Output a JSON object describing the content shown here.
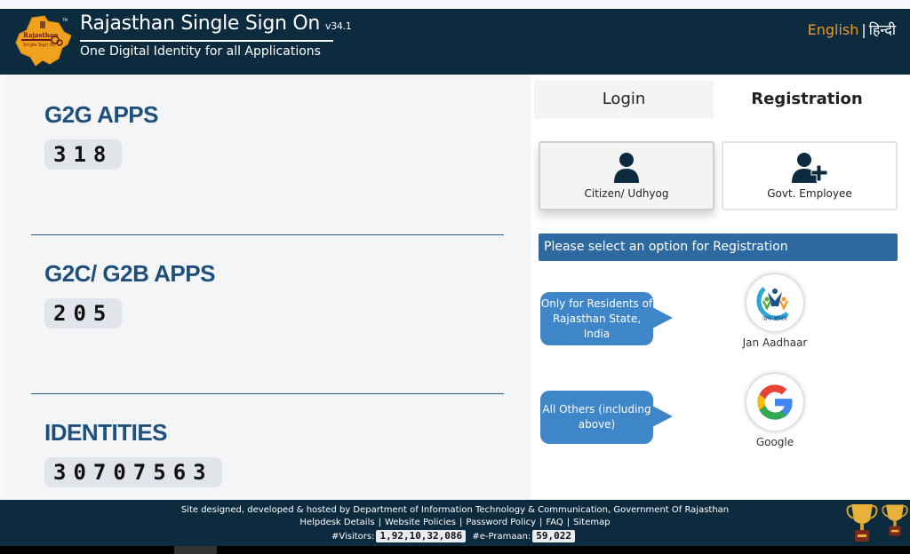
{
  "header": {
    "logo_icon": "rajasthan-sso-logo",
    "title": "Rajasthan Single Sign On",
    "version": "v34.1",
    "subtitle": "One Digital Identity for all Applications",
    "lang_english": "English",
    "lang_separator": "|",
    "lang_hindi": "हिन्दी"
  },
  "stats": [
    {
      "title": "G2G APPS",
      "value": "318"
    },
    {
      "title": "G2C/ G2B APPS",
      "value": "205"
    },
    {
      "title": "IDENTITIES",
      "value": "30707563"
    }
  ],
  "tabs": {
    "login": "Login",
    "registration": "Registration",
    "active": "registration"
  },
  "options": {
    "citizen": {
      "label": "Citizen/ Udhyog",
      "icon": "user-icon",
      "selected": true
    },
    "govt": {
      "label": "Govt. Employee",
      "icon": "user-plus-icon",
      "selected": false
    }
  },
  "banner": "Please select an option for Registration",
  "providers": [
    {
      "bubble": "Only for Residents of Rajasthan State, India",
      "label": "Jan Aadhaar",
      "icon": "jan-aadhaar-icon",
      "icon_text": "जन-आधार"
    },
    {
      "bubble": "All Others (including above)",
      "label": "Google",
      "icon": "google-icon"
    }
  ],
  "footer": {
    "credit": "Site designed, developed & hosted by Department of Information Technology & Communication, Government Of Rajasthan",
    "links": [
      "Helpdesk Details",
      "Website Policies",
      "Password Policy",
      "FAQ",
      "Sitemap"
    ],
    "visitors_label": "#Visitors:",
    "visitors_value": "1,92,10,32,086",
    "epramaan_label": "#e-Pramaan:",
    "epramaan_value": "59,022",
    "trophy_icon": "trophy-icon"
  },
  "colors": {
    "header_bg": "#0d2b3e",
    "accent_blue": "#1e4f7d",
    "banner_blue": "#2e6aa0",
    "bubble_blue": "#3f86c8",
    "english_orange": "#e79b2a"
  }
}
